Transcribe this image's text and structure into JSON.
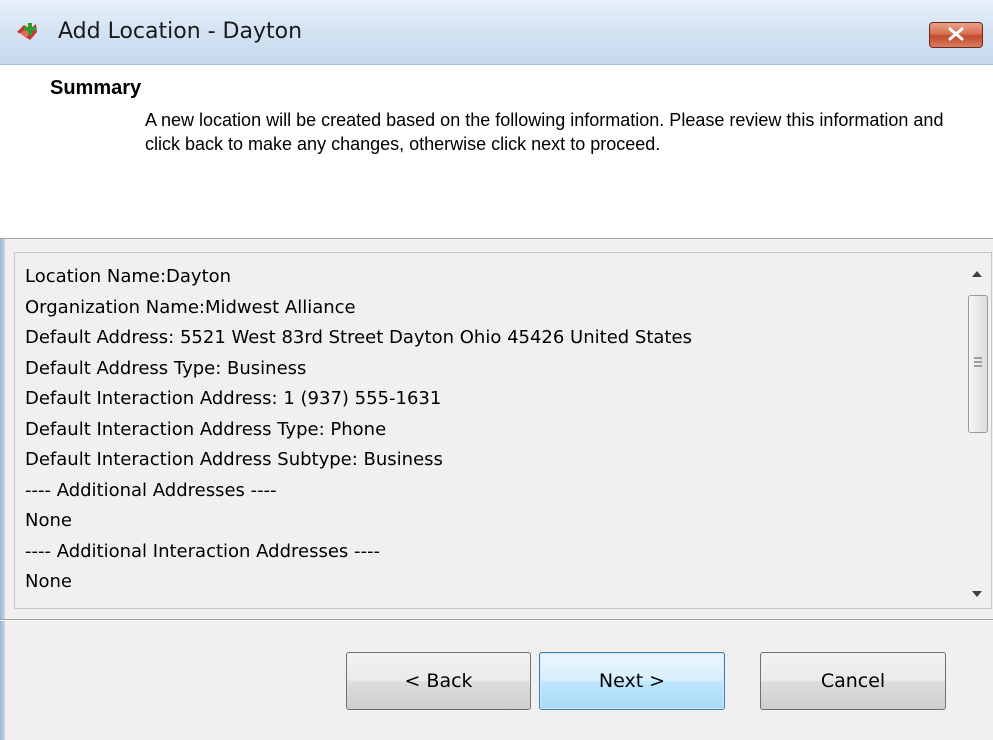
{
  "window": {
    "title": "Add Location - Dayton"
  },
  "header": {
    "title": "Summary",
    "description": "A new location will be created based on the following information.  Please review this information and click back to make any changes, otherwise click next to proceed."
  },
  "summary_lines": [
    "Location Name:Dayton",
    "Organization Name:Midwest Alliance",
    "Default Address:  5521 West 83rd Street Dayton Ohio 45426 United States",
    "Default Address Type:  Business",
    "Default Interaction Address:  1 (937) 555-1631",
    "Default Interaction Address Type:  Phone",
    "Default Interaction Address Subtype:  Business",
    "---- Additional Addresses ----",
    "None",
    "---- Additional Interaction Addresses ----",
    "None"
  ],
  "buttons": {
    "back": "< Back",
    "next": "Next >",
    "cancel": "Cancel"
  },
  "icons": {
    "app": "add-location-icon",
    "close": "close-icon",
    "scroll_up": "scroll-up-arrow-icon",
    "scroll_down": "scroll-down-arrow-icon"
  },
  "colors": {
    "close_button": "#c24a2d",
    "next_button_border": "#3c7fb1"
  }
}
